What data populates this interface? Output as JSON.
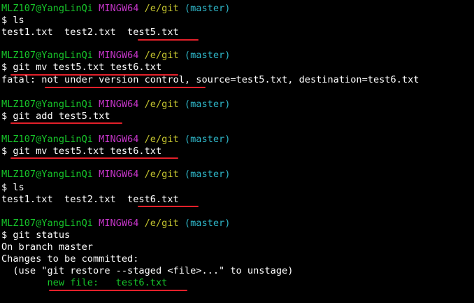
{
  "prompt": {
    "user_host": "MLZ107@YangLinQi",
    "system": "MINGW64",
    "path": "/e/git",
    "branch": "(master)",
    "symbol": "$ "
  },
  "blocks": [
    {
      "command": "ls",
      "output": [
        "test1.txt  test2.txt  test5.txt"
      ]
    },
    {
      "command": "git mv test5.txt test6.txt",
      "output": [
        "fatal: not under version control, source=test5.txt, destination=test6.txt"
      ]
    },
    {
      "command": "git add test5.txt",
      "output": []
    },
    {
      "command": "git mv test5.txt test6.txt",
      "output": []
    },
    {
      "command": "ls",
      "output": [
        "test1.txt  test2.txt  test6.txt"
      ]
    },
    {
      "command": "git status",
      "output": [
        "On branch master",
        "Changes to be committed:",
        "  (use \"git restore --staged <file>...\" to unstage)"
      ],
      "new_file_line": "        new file:   test6.txt"
    }
  ],
  "colors": {
    "background": "#000000",
    "text": "#ffffff",
    "user_host": "#17c62a",
    "system": "#c435c7",
    "path": "#c5c52f",
    "branch": "#2fb7c9",
    "new_file": "#17c62a",
    "underline_marker": "#e4202a"
  }
}
